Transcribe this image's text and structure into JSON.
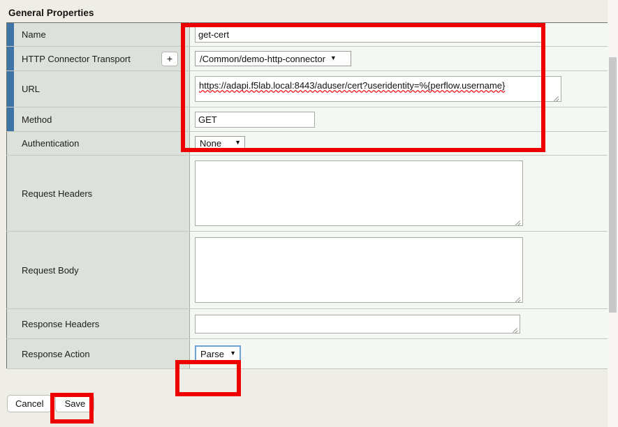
{
  "page": {
    "title": "General Properties",
    "accent_required_color": "#3f74a6",
    "highlight_color": "#ee0000",
    "focus_color": "#6ba2dd"
  },
  "fields": {
    "name": {
      "label": "Name",
      "value": "get-cert",
      "placeholder": "",
      "required": true
    },
    "http_connector_transport": {
      "label": "HTTP Connector Transport",
      "add_button_label": "+",
      "value": "/Common/demo-http-connector",
      "caret": "▼",
      "required": true
    },
    "url": {
      "label": "URL",
      "value": "https://adapi.f5lab.local:8443/aduser/cert?useridentity=%{perflow.username}",
      "required": true
    },
    "method": {
      "label": "Method",
      "value": "GET",
      "required": true
    },
    "authentication": {
      "label": "Authentication",
      "value": "None",
      "caret": "▼",
      "required": false
    },
    "request_headers": {
      "label": "Request Headers",
      "value": "",
      "required": false
    },
    "request_body": {
      "label": "Request Body",
      "value": "",
      "required": false
    },
    "response_headers": {
      "label": "Response Headers",
      "value": "",
      "required": false
    },
    "response_action": {
      "label": "Response Action",
      "value": "Parse",
      "caret": "▼",
      "required": false
    }
  },
  "buttons": {
    "cancel": "Cancel",
    "save": "Save"
  }
}
